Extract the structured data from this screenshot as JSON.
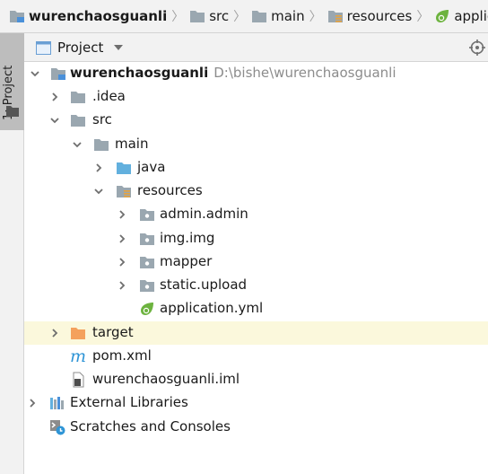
{
  "breadcrumb": {
    "items": [
      {
        "label": "wurenchaosguanli",
        "icon": "module-folder-icon"
      },
      {
        "label": "src",
        "icon": "folder-icon"
      },
      {
        "label": "main",
        "icon": "folder-icon"
      },
      {
        "label": "resources",
        "icon": "resources-folder-icon"
      },
      {
        "label": "application.",
        "icon": "spring-leaf-icon"
      }
    ]
  },
  "side_strip": {
    "tab_label": "1: Project"
  },
  "project_panel": {
    "title": "Project"
  },
  "tree": {
    "root": {
      "label": "wurenchaosguanli",
      "path": "D:\\bishe\\wurenchaosguanli"
    },
    "idea": {
      "label": ".idea"
    },
    "src": {
      "label": "src"
    },
    "main": {
      "label": "main"
    },
    "java": {
      "label": "java"
    },
    "resources": {
      "label": "resources"
    },
    "admin": {
      "label": "admin.admin"
    },
    "img": {
      "label": "img.img"
    },
    "mapper": {
      "label": "mapper"
    },
    "static": {
      "label": "static.upload"
    },
    "application": {
      "label": "application.yml"
    },
    "target": {
      "label": "target"
    },
    "pom": {
      "label": "pom.xml"
    },
    "iml": {
      "label": "wurenchaosguanli.iml"
    },
    "external": {
      "label": "External Libraries"
    },
    "scratches": {
      "label": "Scratches and Consoles"
    }
  },
  "colors": {
    "folder_gray": "#9aa7b0",
    "folder_blue": "#62b0de",
    "folder_orange": "#f4a15d",
    "spring_green": "#6db33f",
    "highlight_row": "#fbf8dc"
  }
}
